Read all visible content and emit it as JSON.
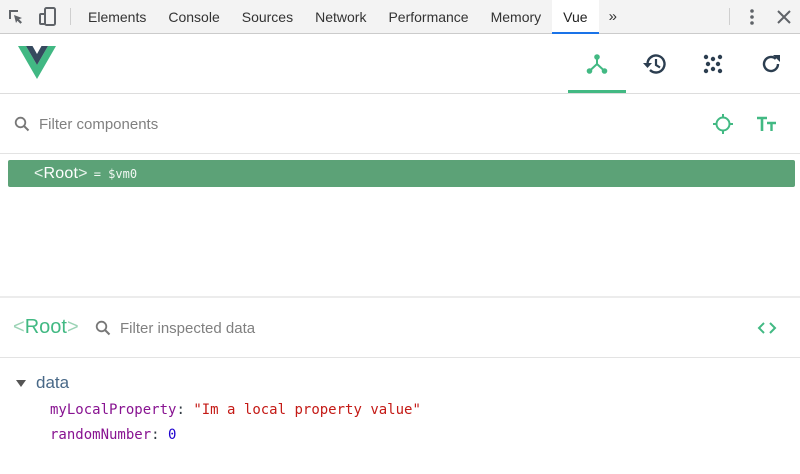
{
  "devtools": {
    "tabs": [
      {
        "label": "Elements",
        "active": false
      },
      {
        "label": "Console",
        "active": false
      },
      {
        "label": "Sources",
        "active": false
      },
      {
        "label": "Network",
        "active": false
      },
      {
        "label": "Performance",
        "active": false
      },
      {
        "label": "Memory",
        "active": false
      },
      {
        "label": "Vue",
        "active": true
      }
    ],
    "more_tabs": "»",
    "icons": {
      "inspect": "cursor-select-icon",
      "device": "device-toggle-icon",
      "menu": "kebab-menu-icon",
      "close": "close-icon"
    },
    "accent_color": "#1a73e8"
  },
  "vue": {
    "brand_color": "#42b983",
    "header_buttons": [
      {
        "name": "components-tab",
        "icon": "component-tree-icon",
        "active": true
      },
      {
        "name": "vuex-tab",
        "icon": "history-icon",
        "active": false
      },
      {
        "name": "events-tab",
        "icon": "events-dots-icon",
        "active": false
      },
      {
        "name": "refresh-button",
        "icon": "refresh-icon",
        "active": false
      }
    ]
  },
  "filter": {
    "placeholder": "Filter components",
    "value": ""
  },
  "tree": {
    "selected": {
      "open": "<",
      "name": "Root",
      "close": ">",
      "instance": "= $vm0"
    },
    "selected_bg": "#5ca277"
  },
  "inspector": {
    "title_open": "<",
    "title_name": "Root",
    "title_close": ">",
    "filter_placeholder": "Filter inspected data",
    "filter_value": ""
  },
  "data": {
    "section_label": "data",
    "properties": [
      {
        "key": "myLocalProperty",
        "colon": ":",
        "value": "\"Im a local property value\"",
        "type": "string"
      },
      {
        "key": "randomNumber",
        "colon": ":",
        "value": "0",
        "type": "number"
      }
    ]
  }
}
